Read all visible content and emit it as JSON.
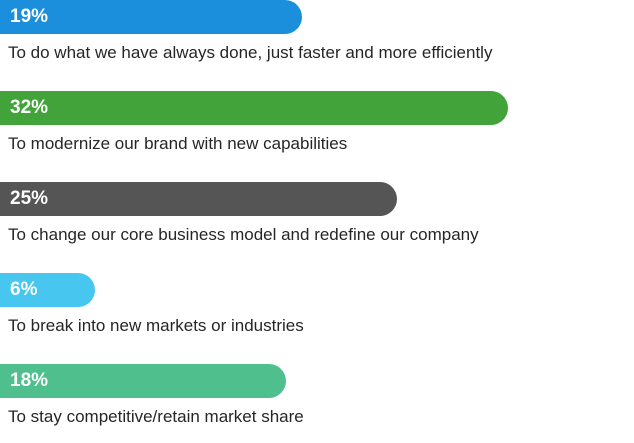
{
  "chart_data": {
    "type": "bar",
    "orientation": "horizontal",
    "categories": [
      "To do what we have always done, just faster and more efficiently",
      "To modernize our brand with new capabilities",
      "To change our core business model and redefine our company",
      "To break into new markets or industries",
      "To stay competitive/retain market share"
    ],
    "values": [
      19,
      32,
      25,
      6,
      18
    ],
    "value_labels": [
      "19%",
      "32%",
      "25%",
      "6%",
      "18%"
    ],
    "colors": [
      "#1b8fdc",
      "#41a33a",
      "#555555",
      "#47c6f0",
      "#4fc08d"
    ],
    "xlim": [
      0,
      38
    ],
    "grid": false,
    "legend": "none"
  }
}
